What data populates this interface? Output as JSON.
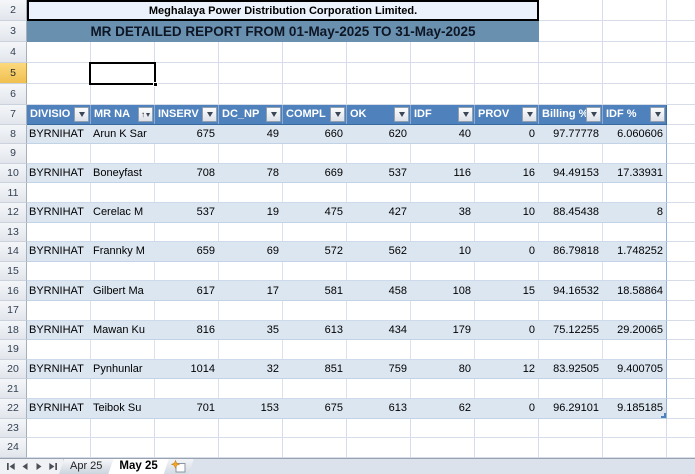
{
  "titles": {
    "company": "Meghalaya Power Distribution Corporation Limited.",
    "report": "MR DETAILED REPORT FROM 01-May-2025 TO 31-May-2025"
  },
  "row_numbers": [
    "2",
    "3",
    "4",
    "5",
    "6",
    "7",
    "8",
    "9",
    "10",
    "11",
    "12",
    "13",
    "14",
    "15",
    "16",
    "17",
    "18",
    "19",
    "20",
    "21",
    "22",
    "23",
    "24"
  ],
  "table": {
    "columns": [
      {
        "label": "DIVISIO",
        "icon": "filter-dropdown"
      },
      {
        "label": "MR NA",
        "icon": "sort-ascending-filter-dropdown"
      },
      {
        "label": "INSERV",
        "icon": "filter-dropdown"
      },
      {
        "label": "DC_NP",
        "icon": "filter-dropdown"
      },
      {
        "label": "COMPL",
        "icon": "filter-dropdown"
      },
      {
        "label": "OK",
        "icon": "filter-dropdown"
      },
      {
        "label": "IDF",
        "icon": "filter-dropdown"
      },
      {
        "label": "PROV",
        "icon": "filter-dropdown"
      },
      {
        "label": "Billing %",
        "icon": "filter-dropdown"
      },
      {
        "label": "IDF %",
        "icon": "filter-dropdown"
      }
    ],
    "rows": [
      {
        "sheet_row": "8",
        "cells": [
          "BYRNIHAT",
          "Arun K Sar",
          "675",
          "49",
          "660",
          "620",
          "40",
          "0",
          "97.77778",
          "6.060606"
        ]
      },
      {
        "sheet_row": "10",
        "cells": [
          "BYRNIHAT",
          "Boneyfast",
          "708",
          "78",
          "669",
          "537",
          "116",
          "16",
          "94.49153",
          "17.33931"
        ]
      },
      {
        "sheet_row": "12",
        "cells": [
          "BYRNIHAT",
          "Cerelac M",
          "537",
          "19",
          "475",
          "427",
          "38",
          "10",
          "88.45438",
          "8"
        ]
      },
      {
        "sheet_row": "14",
        "cells": [
          "BYRNIHAT",
          "Frannky M",
          "659",
          "69",
          "572",
          "562",
          "10",
          "0",
          "86.79818",
          "1.748252"
        ]
      },
      {
        "sheet_row": "16",
        "cells": [
          "BYRNIHAT",
          "Gilbert Ma",
          "617",
          "17",
          "581",
          "458",
          "108",
          "15",
          "94.16532",
          "18.58864"
        ]
      },
      {
        "sheet_row": "18",
        "cells": [
          "BYRNIHAT",
          "Mawan Ku",
          "816",
          "35",
          "613",
          "434",
          "179",
          "0",
          "75.12255",
          "29.20065"
        ]
      },
      {
        "sheet_row": "20",
        "cells": [
          "BYRNIHAT",
          "Pynhunlar",
          "1014",
          "32",
          "851",
          "759",
          "80",
          "12",
          "83.92505",
          "9.400705"
        ]
      },
      {
        "sheet_row": "22",
        "cells": [
          "BYRNIHAT",
          "Teibok Su",
          "701",
          "153",
          "675",
          "613",
          "62",
          "0",
          "96.29101",
          "9.185185"
        ]
      }
    ]
  },
  "selection": {
    "active_row_header": "5",
    "selected_cell": "C5"
  },
  "sheet_tabs": {
    "items": [
      {
        "label": "Apr 25",
        "active": false
      },
      {
        "label": "May 25",
        "active": true
      }
    ]
  },
  "colors": {
    "table_header_fill": "#4f81bd",
    "band_fill": "#dce6f1",
    "report_banner_fill": "#6a90b0",
    "company_banner_fill": "#ebf2fb",
    "selected_row_header_fill": "#f0bf4f"
  }
}
